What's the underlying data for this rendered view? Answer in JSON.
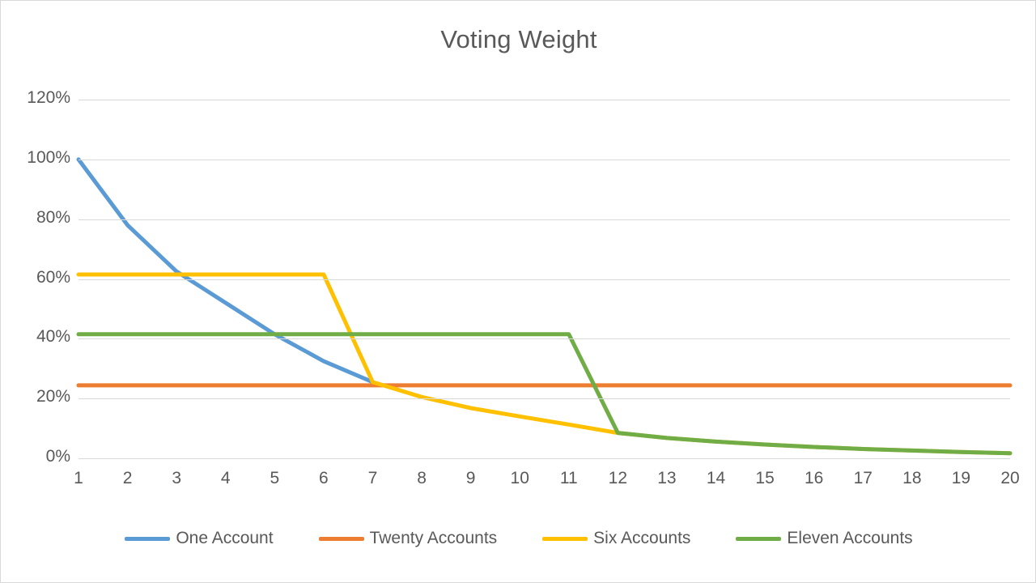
{
  "chart_data": {
    "type": "line",
    "title": "Voting Weight",
    "xlabel": "",
    "ylabel": "",
    "xlim": [
      1,
      20
    ],
    "ylim": [
      0,
      1.2
    ],
    "ytick_labels": [
      "120%",
      "100%",
      "80%",
      "60%",
      "40%",
      "20%",
      "0%"
    ],
    "ytick_values": [
      1.2,
      1.0,
      0.8,
      0.6,
      0.4,
      0.2,
      0.0
    ],
    "grid": true,
    "legend_position": "bottom",
    "x": [
      1,
      2,
      3,
      4,
      5,
      6,
      7,
      8,
      9,
      10,
      11,
      12,
      13,
      14,
      15,
      16,
      17,
      18,
      19,
      20
    ],
    "categories": [
      "1",
      "2",
      "3",
      "4",
      "5",
      "6",
      "7",
      "8",
      "9",
      "10",
      "11",
      "12",
      "13",
      "14",
      "15",
      "16",
      "17",
      "18",
      "19",
      "20"
    ],
    "series": [
      {
        "name": "One Account",
        "color": "#5b9bd5",
        "values": [
          1.0,
          0.78,
          0.625,
          0.52,
          0.415,
          0.325,
          0.255,
          null,
          null,
          null,
          null,
          null,
          null,
          null,
          null,
          null,
          null,
          null,
          null,
          null
        ]
      },
      {
        "name": "Twenty Accounts",
        "color": "#ed7d31",
        "values": [
          0.244,
          0.244,
          0.244,
          0.244,
          0.244,
          0.244,
          0.244,
          0.244,
          0.244,
          0.244,
          0.244,
          0.244,
          0.244,
          0.244,
          0.244,
          0.244,
          0.244,
          0.244,
          0.244,
          0.244
        ]
      },
      {
        "name": "Six Accounts",
        "color": "#ffc000",
        "values": [
          0.615,
          0.615,
          0.615,
          0.615,
          0.615,
          0.615,
          0.255,
          0.205,
          0.168,
          0.14,
          0.113,
          0.085,
          0.068,
          0.056,
          0.046,
          0.038,
          0.031,
          0.026,
          0.021,
          0.017
        ]
      },
      {
        "name": "Eleven Accounts",
        "color": "#70ad47",
        "values": [
          0.415,
          0.415,
          0.415,
          0.415,
          0.415,
          0.415,
          0.415,
          0.415,
          0.415,
          0.415,
          0.415,
          0.085,
          0.068,
          0.056,
          0.046,
          0.038,
          0.031,
          0.026,
          0.021,
          0.017
        ]
      }
    ]
  },
  "legend": {
    "items": [
      {
        "label": "One Account",
        "color": "#5b9bd5"
      },
      {
        "label": "Twenty Accounts",
        "color": "#ed7d31"
      },
      {
        "label": "Six Accounts",
        "color": "#ffc000"
      },
      {
        "label": "Eleven Accounts",
        "color": "#70ad47"
      }
    ]
  }
}
